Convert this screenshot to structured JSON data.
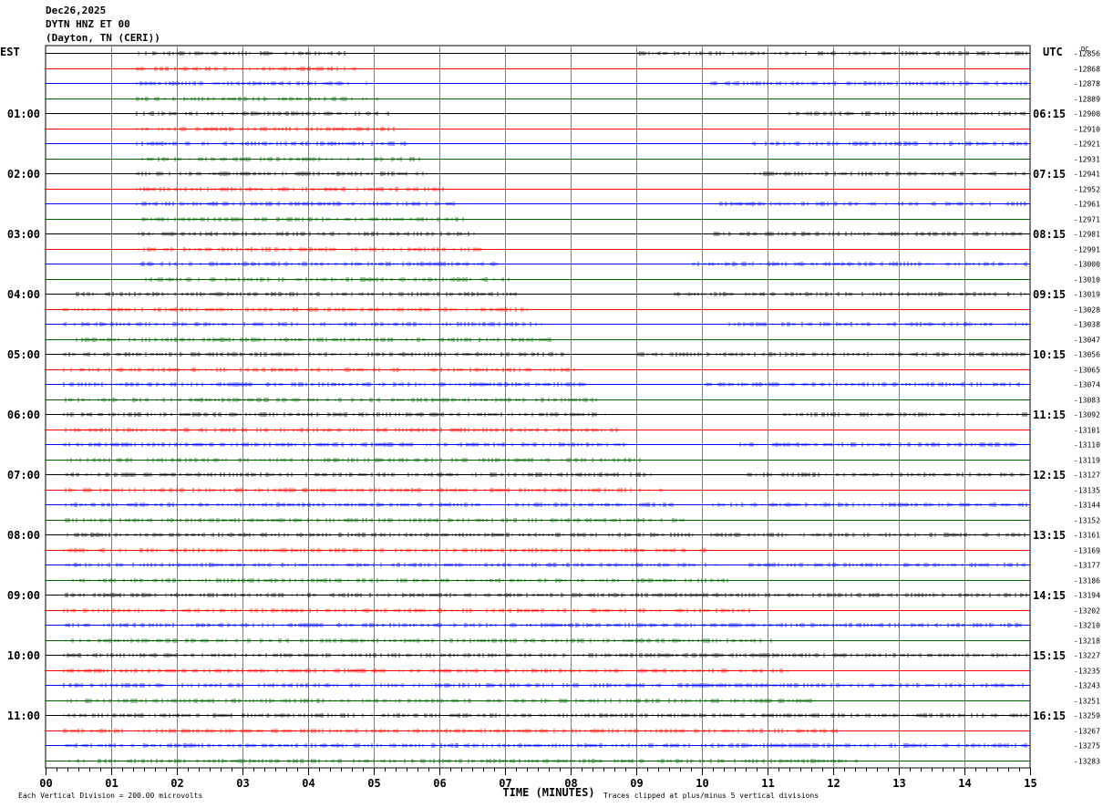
{
  "header": {
    "date": "Dec26,2025",
    "station": "DYTN HNZ ET 00",
    "location": "(Dayton, TN (CERI))"
  },
  "chart_data": {
    "type": "line",
    "title": "",
    "left_label": "EST",
    "right_label": "UTC",
    "dc_label": "DC",
    "xlabel": "TIME (MINUTES)",
    "x_range": [
      0,
      15
    ],
    "x_ticks": [
      "00",
      "01",
      "02",
      "03",
      "04",
      "05",
      "06",
      "07",
      "08",
      "09",
      "10",
      "11",
      "12",
      "13",
      "14",
      "15"
    ],
    "grid": true,
    "row_count": 48,
    "minutes_per_row": 15,
    "trace_colors": [
      "#000000",
      "#ff0000",
      "#0000ff",
      "#006400"
    ],
    "grid_color": "#808080",
    "left_time_labels": [
      {
        "row": 4,
        "label": "01:00"
      },
      {
        "row": 8,
        "label": "02:00"
      },
      {
        "row": 12,
        "label": "03:00"
      },
      {
        "row": 16,
        "label": "04:00"
      },
      {
        "row": 20,
        "label": "05:00"
      },
      {
        "row": 24,
        "label": "06:00"
      },
      {
        "row": 28,
        "label": "07:00"
      },
      {
        "row": 32,
        "label": "08:00"
      },
      {
        "row": 36,
        "label": "09:00"
      },
      {
        "row": 40,
        "label": "10:00"
      },
      {
        "row": 44,
        "label": "11:00"
      }
    ],
    "right_time_labels": [
      {
        "row": 4,
        "label": "06:15"
      },
      {
        "row": 8,
        "label": "07:15"
      },
      {
        "row": 12,
        "label": "08:15"
      },
      {
        "row": 16,
        "label": "09:15"
      },
      {
        "row": 20,
        "label": "10:15"
      },
      {
        "row": 24,
        "label": "11:15"
      },
      {
        "row": 28,
        "label": "12:15"
      },
      {
        "row": 32,
        "label": "13:15"
      },
      {
        "row": 36,
        "label": "14:15"
      },
      {
        "row": 40,
        "label": "15:15"
      },
      {
        "row": 44,
        "label": "16:15"
      }
    ],
    "dc_offsets": [
      "-12856",
      "-12868",
      "-12878",
      "-12889",
      "-12900",
      "-12910",
      "-12921",
      "-12931",
      "-12941",
      "-12952",
      "-12961",
      "-12971",
      "-12981",
      "-12991",
      "-13000",
      "-13010",
      "-13019",
      "-13028",
      "-13038",
      "-13047",
      "-13056",
      "-13065",
      "-13074",
      "-13083",
      "-13092",
      "-13101",
      "-13110",
      "-13119",
      "-13127",
      "-13135",
      "-13144",
      "-13152",
      "-13161",
      "-13169",
      "-13177",
      "-13186",
      "-13194",
      "-13202",
      "-13210",
      "-13218",
      "-13227",
      "-13235",
      "-13243",
      "-13251",
      "-13259",
      "-13267",
      "-13275",
      "-13283"
    ],
    "footer_scale": "Each Vertical Division =  200.00 microvolts",
    "footer_clip": "Traces clipped at plus/minus 5 vertical divisions"
  }
}
